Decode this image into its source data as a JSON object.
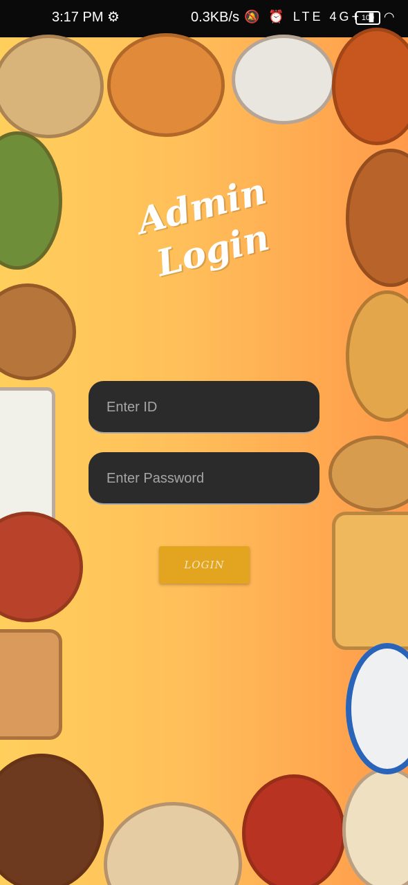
{
  "status_bar": {
    "time": "3:17 PM",
    "gear_icon": "⚙",
    "net_speed": "0.3KB/s",
    "icons": "🔕 ⏰ LTE 4G+ ▮ ◠",
    "battery": "100"
  },
  "page": {
    "title_line1": "Admin",
    "title_line2": "Login"
  },
  "form": {
    "id_placeholder": "Enter ID",
    "password_placeholder": "Enter Password",
    "login_label": "LOGIN"
  },
  "colors": {
    "accent": "#e3a41f",
    "field_bg": "#2b2b2b"
  }
}
